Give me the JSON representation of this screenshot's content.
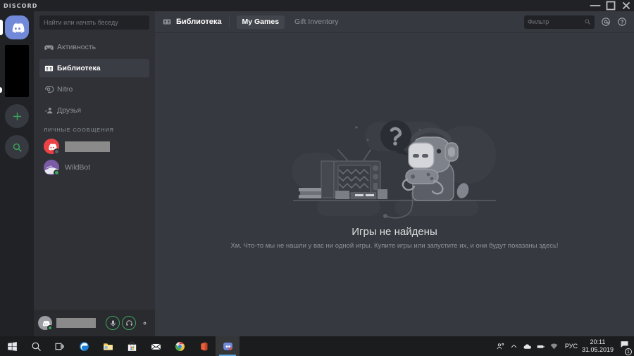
{
  "window": {
    "brand": "DISCORD",
    "controls": [
      {
        "name": "minimize-button",
        "glyph": "─"
      },
      {
        "name": "maximize-button",
        "glyph": "□"
      },
      {
        "name": "close-button",
        "glyph": "✕"
      }
    ]
  },
  "rail": {
    "home_tooltip": "Discord",
    "add_server_label": "+",
    "explore_label": "Explore"
  },
  "sidebar": {
    "search": {
      "placeholder": "Найти или начать беседу"
    },
    "nav": [
      {
        "label": "Активность",
        "icon": "gamepad-icon",
        "active": false
      },
      {
        "label": "Библиотека",
        "icon": "library-icon",
        "active": true
      },
      {
        "label": "Nitro",
        "icon": "nitro-icon",
        "active": false
      },
      {
        "label": "Друзья",
        "icon": "friends-icon",
        "active": false
      }
    ],
    "dm_header": "ЛИЧНЫЕ СООБЩЕНИЯ",
    "dms": [
      {
        "name": "",
        "redacted": true,
        "status": "offline"
      },
      {
        "name": "WildBot",
        "redacted": false,
        "status": "online"
      }
    ]
  },
  "user_panel": {
    "username": "",
    "redacted": true,
    "status": "online",
    "mic_label": "Микрофон",
    "headphones_label": "Наушники",
    "settings_label": "Настройки",
    "active_color": "#3ba55c"
  },
  "topbar": {
    "title": "Библиотека",
    "tabs": [
      {
        "label": "My Games",
        "active": true
      },
      {
        "label": "Gift Inventory",
        "active": false
      }
    ],
    "filter": {
      "placeholder": "Фильтр"
    },
    "mentions_label": "@",
    "help_label": "?"
  },
  "empty_state": {
    "title": "Игры не найдены",
    "subtitle": "Хм. Что-то мы не нашли у вас ни одной игры. Купите игры или запустите их, и они будут показаны здесь!"
  },
  "taskbar": {
    "items": [
      {
        "name": "start-button",
        "icon": "windows-icon"
      },
      {
        "name": "search-button",
        "icon": "search-icon"
      },
      {
        "name": "task-view-button",
        "icon": "task-view-icon"
      },
      {
        "name": "edge-button",
        "icon": "edge-icon"
      },
      {
        "name": "file-explorer-button",
        "icon": "folder-icon"
      },
      {
        "name": "store-button",
        "icon": "store-icon"
      },
      {
        "name": "mail-button",
        "icon": "mail-icon"
      },
      {
        "name": "chrome-button",
        "icon": "chrome-icon"
      },
      {
        "name": "office-button",
        "icon": "office-icon"
      },
      {
        "name": "discord-button",
        "icon": "discord-icon"
      }
    ],
    "tray": {
      "language": "РУС",
      "time": "20:11",
      "date": "31.05.2019",
      "notification_count": "1"
    }
  }
}
